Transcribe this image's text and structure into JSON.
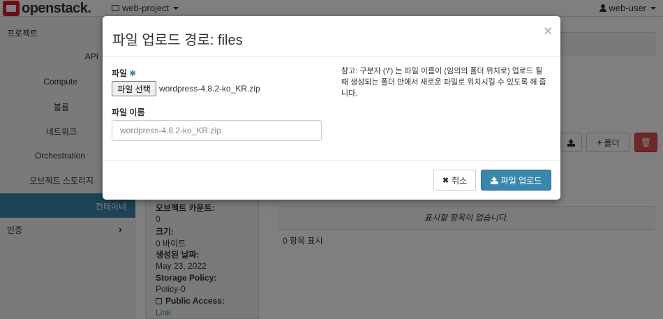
{
  "navbar": {
    "logo_text": "openstack.",
    "project": "web-project",
    "user": "web-user"
  },
  "sidebar": {
    "project_label": "프로젝트",
    "items": [
      "API",
      "Compute",
      "볼륨",
      "네트워크",
      "Orchestration",
      "오브젝트 스토리지",
      "컨테이너"
    ],
    "auth_label": "인증"
  },
  "container_details": {
    "object_count_label": "오브젝트 카운트:",
    "object_count": "0",
    "size_label": "크기:",
    "size": "0 바이트",
    "created_label": "생성된 날짜:",
    "created": "May 23, 2022",
    "policy_label": "Storage Policy:",
    "policy": "Policy-0",
    "public_access_label": "Public Access:",
    "public_access_link": "Link"
  },
  "toolbar": {
    "folder_label": "폴더"
  },
  "table": {
    "empty_message": "표시할 항목이 없습니다.",
    "count_text": "0 항목 표시"
  },
  "modal": {
    "title": "파일 업로드 경로: files",
    "file_label": "파일",
    "required_mark": "✱",
    "choose_file_label": "파일 선택",
    "chosen_file": "wordpress-4.8.2-ko_KR.zip",
    "filename_label": "파일 이름",
    "filename_value": "wordpress-4.8.2-ko_KR.zip",
    "help_text": "참고: 구분자 ('/') 는 파일 이름이 (임의의 폴더 위치로) 업로드 될 때 생성되는 폴더 안에서 새로운 파일로 위치시킬 수 있도록 해 줍니다.",
    "cancel_label": "취소",
    "upload_label": "파일 업로드",
    "close_glyph": "×"
  },
  "colors": {
    "accent": "#3a87ad",
    "danger": "#d9534f",
    "brand_red": "#da1a32"
  }
}
